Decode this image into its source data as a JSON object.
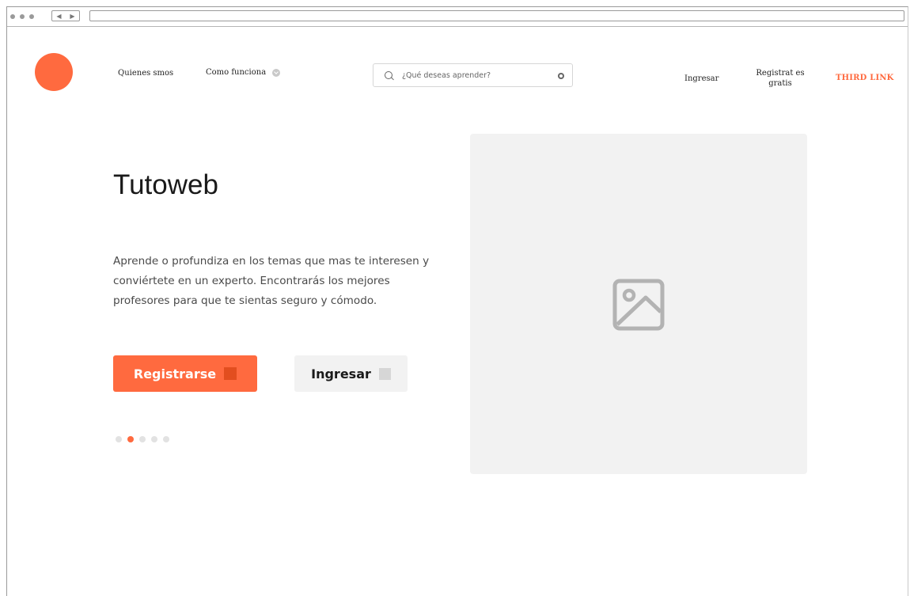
{
  "brand": {
    "accent": "#ff6a3f",
    "accent_dark": "#e24e1f"
  },
  "nav": {
    "quienes": "Quienes smos",
    "como": "Como funciona",
    "ingresar": "Ingresar",
    "registrate": "Registrat es gratis",
    "third": "THIRD LINK"
  },
  "search": {
    "placeholder": "¿Qué deseas aprender?"
  },
  "hero": {
    "title": "Tutoweb",
    "text": "Aprende o profundiza en los temas que mas te interesen y conviértete en un experto. Encontrarás los mejores profesores para que te sientas seguro y cómodo.",
    "primary_label": "Registrarse",
    "secondary_label": "Ingresar"
  },
  "carousel": {
    "total": 5,
    "active_index": 2
  },
  "icons": {
    "search": "search-icon",
    "clear": "clear-icon",
    "chevron": "chevron-down-icon",
    "image": "image-placeholder-icon"
  }
}
